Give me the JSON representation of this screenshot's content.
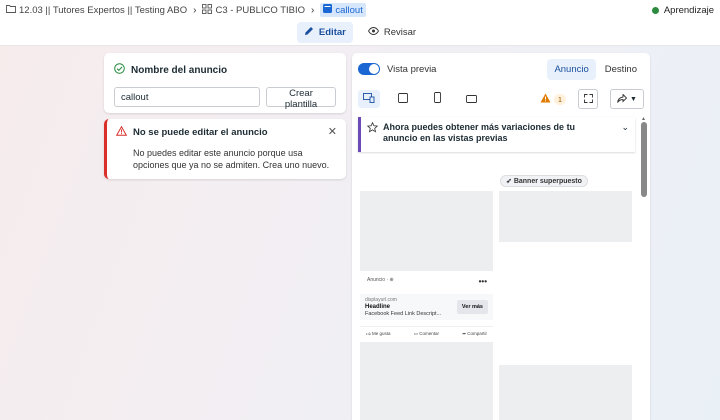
{
  "breadcrumb": {
    "campaign": "12.03 || Tutores Expertos || Testing ABO",
    "adset": "C3 - PUBLICO TIBIO",
    "ad": "callout"
  },
  "status": {
    "label": "Aprendizaje",
    "color": "#2c8a3e"
  },
  "toolbar": {
    "edit_label": "Editar",
    "review_label": "Revisar"
  },
  "ad_name": {
    "title": "Nombre del anuncio",
    "value": "callout",
    "template_button": "Crear plantilla"
  },
  "error": {
    "title": "No se puede editar el anuncio",
    "body": "No puedes editar este anuncio porque usa opciones que ya no se admiten. Crea uno nuevo.",
    "accent_color": "#d9302a"
  },
  "preview": {
    "toggle_label": "Vista previa",
    "tabs": [
      {
        "label": "Anuncio",
        "active": true
      },
      {
        "label": "Destino",
        "active": false
      }
    ],
    "warning_count": "1",
    "banner_text": "Ahora puedes obtener más variaciones de tu anuncio en las vistas previas",
    "overlay_label": "Banner superpuesto"
  },
  "fb_post": {
    "page_label": "Anuncio · ⊕",
    "url": "displayurl.com",
    "headline": "Headline",
    "description": "Facebook Feed Link Descript...",
    "cta": "Ver más",
    "actions": [
      "Me gusta",
      "Comentar",
      "Compartir"
    ]
  },
  "colors": {
    "accent": "#1a66d2",
    "banner_accent": "#6c4ab6"
  }
}
